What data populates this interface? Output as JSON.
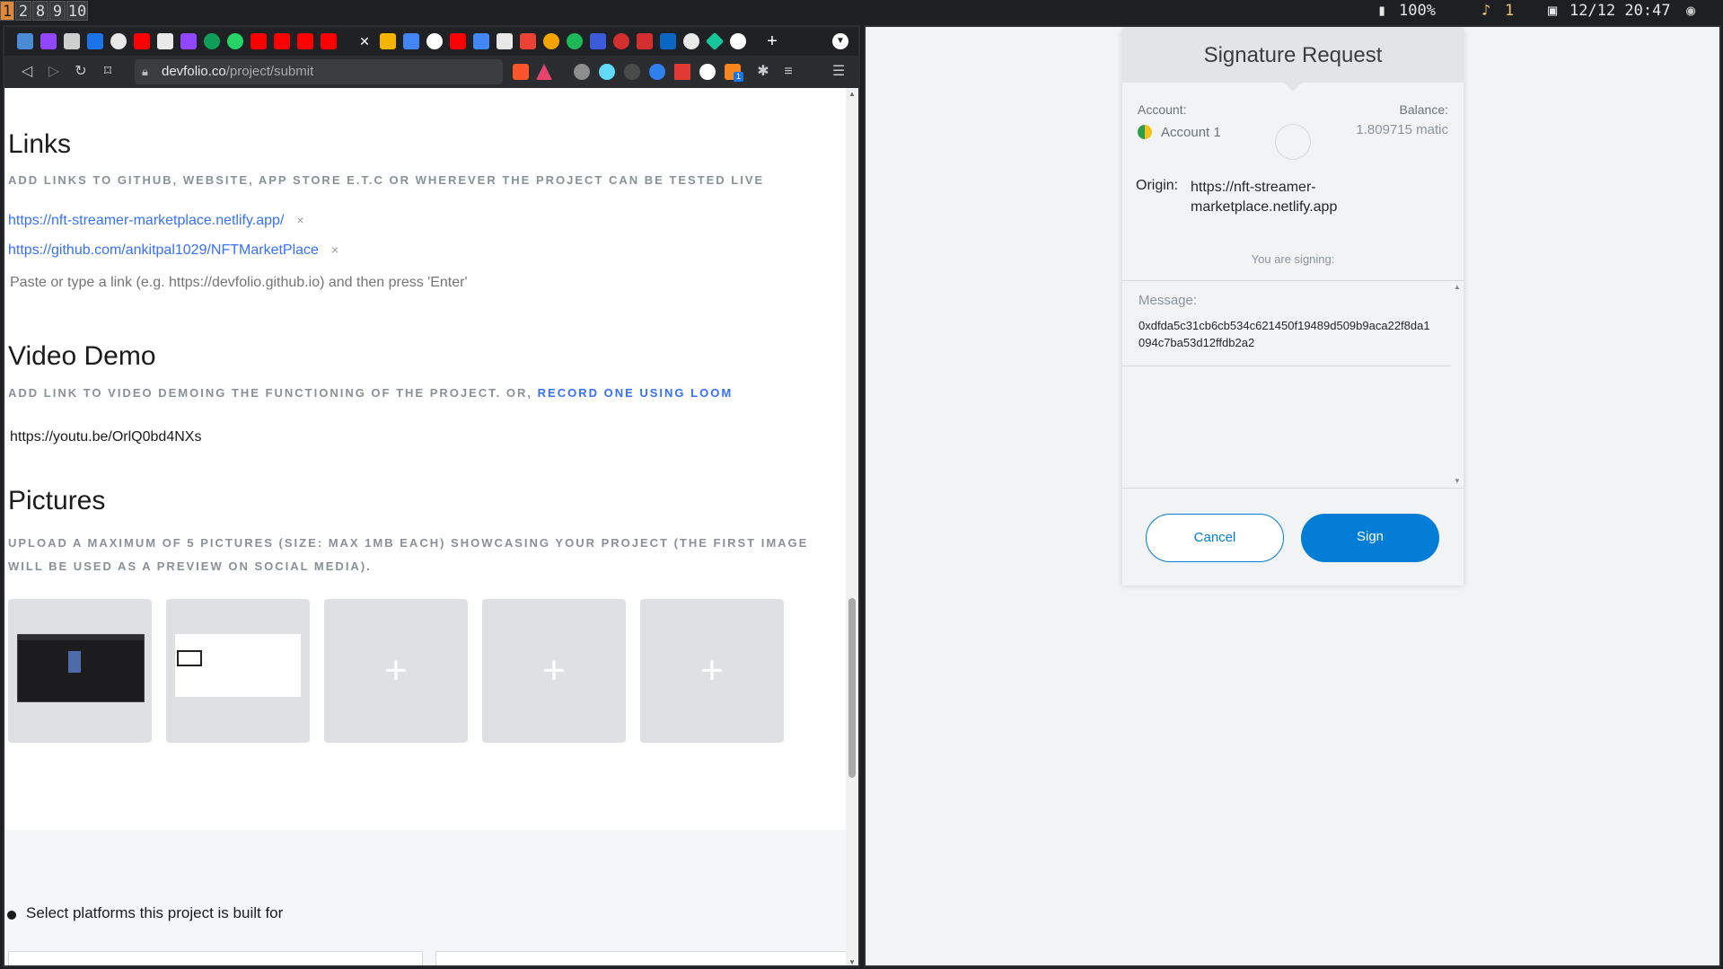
{
  "topbar": {
    "workspaces": [
      "1",
      "2",
      "8",
      "9",
      "10"
    ],
    "battery": "100%",
    "notif_count": "1",
    "datetime": "12/12 20:47"
  },
  "browser": {
    "url_domain": "devfolio.co",
    "url_path": "/project/submit",
    "ext_badge": "1"
  },
  "page": {
    "links": {
      "heading": "Links",
      "subtitle": "ADD LINKS TO GITHUB, WEBSITE, APP STORE E.T.C OR WHEREVER THE PROJECT CAN BE TESTED LIVE",
      "items": [
        "https://nft-streamer-marketplace.netlify.app/",
        "https://github.com/ankitpal1029/NFTMarketPlace"
      ],
      "remove_glyph": "×",
      "placeholder": "Paste or type a link (e.g. https://devfolio.github.io) and then press 'Enter'"
    },
    "video": {
      "heading": "Video Demo",
      "subtitle": "ADD LINK TO VIDEO DEMOING THE FUNCTIONING OF THE PROJECT. OR,",
      "loom_link": "RECORD ONE USING LOOM",
      "value": "https://youtu.be/OrlQ0bd4NXs"
    },
    "pictures": {
      "heading": "Pictures",
      "subtitle": "UPLOAD A MAXIMUM OF 5 PICTURES (SIZE: MAX 1MB EACH) SHOWCASING YOUR PROJECT (THE FIRST IMAGE WILL BE USED AS A PREVIEW ON SOCIAL MEDIA).",
      "add_glyph": "+"
    },
    "platforms_label": "Select platforms this project is built for"
  },
  "signature": {
    "title": "Signature Request",
    "account_label": "Account:",
    "account_name": "Account 1",
    "balance_label": "Balance:",
    "balance_value": "1.809715 matic",
    "origin_label": "Origin:",
    "origin_value": "https://nft-streamer-marketplace.netlify.app",
    "signing_label": "You are signing:",
    "message_label": "Message:",
    "message_value": "0xdfda5c31cb6cb534c621450f19489d509b9aca22f8da1094c7ba53d12ffdb2a2",
    "cancel": "Cancel",
    "sign": "Sign"
  },
  "colors": {
    "accent_blue": "#037dd6",
    "link_blue": "#3770ff",
    "workspace_active": "#e0883a"
  }
}
